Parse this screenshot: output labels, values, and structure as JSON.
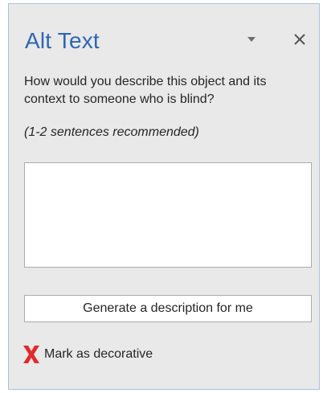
{
  "pane": {
    "title": "Alt Text",
    "dropdown_icon": "chevron-down-icon",
    "close_icon": "close-icon"
  },
  "prompt": {
    "question": "How would you describe this object and its context to someone who is blind?",
    "hint": "(1-2 sentences recommended)"
  },
  "description": {
    "value": "",
    "placeholder": ""
  },
  "generate_button": {
    "label": "Generate a description for me"
  },
  "decorative": {
    "label": "Mark as decorative",
    "checked": false,
    "mark_color": "#e02b2b"
  },
  "colors": {
    "title": "#2f66b2",
    "pane_bg": "#e9e9e9",
    "border": "#ababab"
  }
}
